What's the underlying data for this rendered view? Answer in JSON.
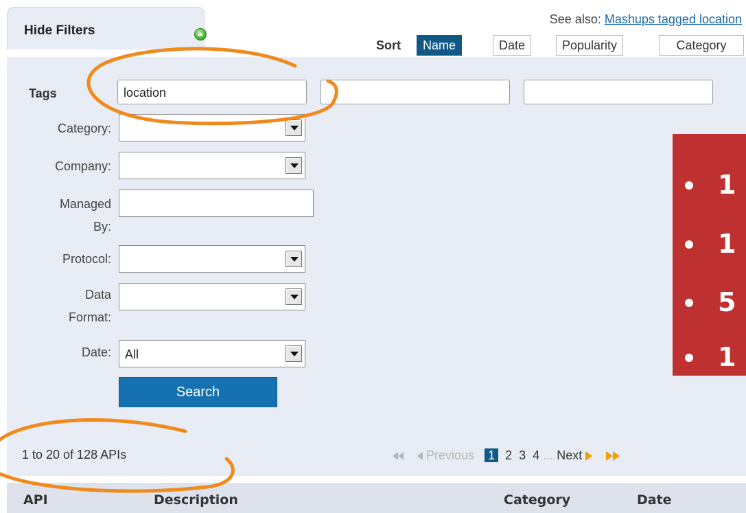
{
  "filters_tab": {
    "label": "Hide Filters",
    "icon": "collapse-up-icon"
  },
  "see_also": {
    "prefix": "See also:",
    "link": "Mashups tagged location"
  },
  "sort": {
    "label": "Sort",
    "options": [
      "Name",
      "Date",
      "Popularity",
      "Category"
    ],
    "active": "Name"
  },
  "form": {
    "tags_label": "Tags",
    "tags_values": [
      "location",
      "",
      ""
    ],
    "category_label": "Category:",
    "company_label": "Company:",
    "managed_by_label_1": "Managed",
    "managed_by_label_2": "By:",
    "protocol_label": "Protocol:",
    "data_format_label_1": "Data",
    "data_format_label_2": "Format:",
    "date_label": "Date:",
    "date_value": "All",
    "search_button": "Search"
  },
  "results": {
    "count_text": "1 to 20 of 128 APIs",
    "previous_label": "Previous",
    "pages": [
      "1",
      "2",
      "3",
      "4"
    ],
    "current_page": "1",
    "ellipsis": "...",
    "next_label": "Next"
  },
  "table": {
    "columns": [
      "API",
      "Description",
      "Category",
      "Date"
    ]
  },
  "overlay": {
    "bullets": [
      "1",
      "1",
      "5",
      "1"
    ]
  },
  "colors": {
    "accent": "#105987",
    "button": "#1671b0",
    "panel": "#e8ecf5",
    "annotation": "#f08a1c",
    "overlay": "#bf3131"
  }
}
